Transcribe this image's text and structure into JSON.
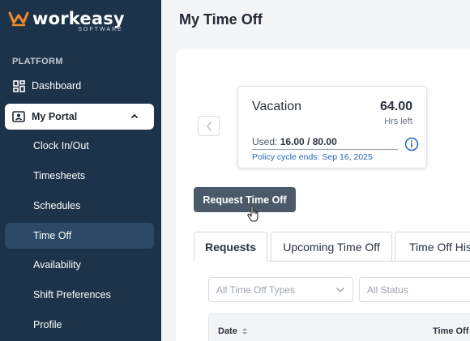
{
  "brand": {
    "name": "workeasy",
    "tagline": "SOFTWARE",
    "accent": "#f08a2b"
  },
  "sidebar": {
    "section_label": "PLATFORM",
    "dashboard": {
      "label": "Dashboard",
      "icon": "dashboard-icon"
    },
    "portal": {
      "label": "My Portal",
      "icon": "portal-icon",
      "expanded": true
    },
    "sub_items": [
      {
        "label": "Clock In/Out",
        "active": false
      },
      {
        "label": "Timesheets",
        "active": false
      },
      {
        "label": "Schedules",
        "active": false
      },
      {
        "label": "Time Off",
        "active": true
      },
      {
        "label": "Availability",
        "active": false
      },
      {
        "label": "Shift Preferences",
        "active": false
      },
      {
        "label": "Profile",
        "active": false
      }
    ],
    "bg_color": "#1c3349"
  },
  "page": {
    "title": "My Time Off"
  },
  "balance_card": {
    "type": "Vacation",
    "hours": "64.00",
    "hours_unit": "Hrs left",
    "used_label": "Used:",
    "used_value": "16.00 / 80.00",
    "policy": "Policy cycle ends: Sep 16, 2025"
  },
  "request_button": {
    "label": "Request Time Off"
  },
  "tabs": [
    {
      "label": "Requests",
      "active": true
    },
    {
      "label": "Upcoming Time Off",
      "active": false
    },
    {
      "label": "Time Off His",
      "active": false
    }
  ],
  "filters": {
    "type_placeholder": "All Time Off Types",
    "status_placeholder": "All Status"
  },
  "table": {
    "columns": [
      "Date",
      "Time Off"
    ]
  }
}
